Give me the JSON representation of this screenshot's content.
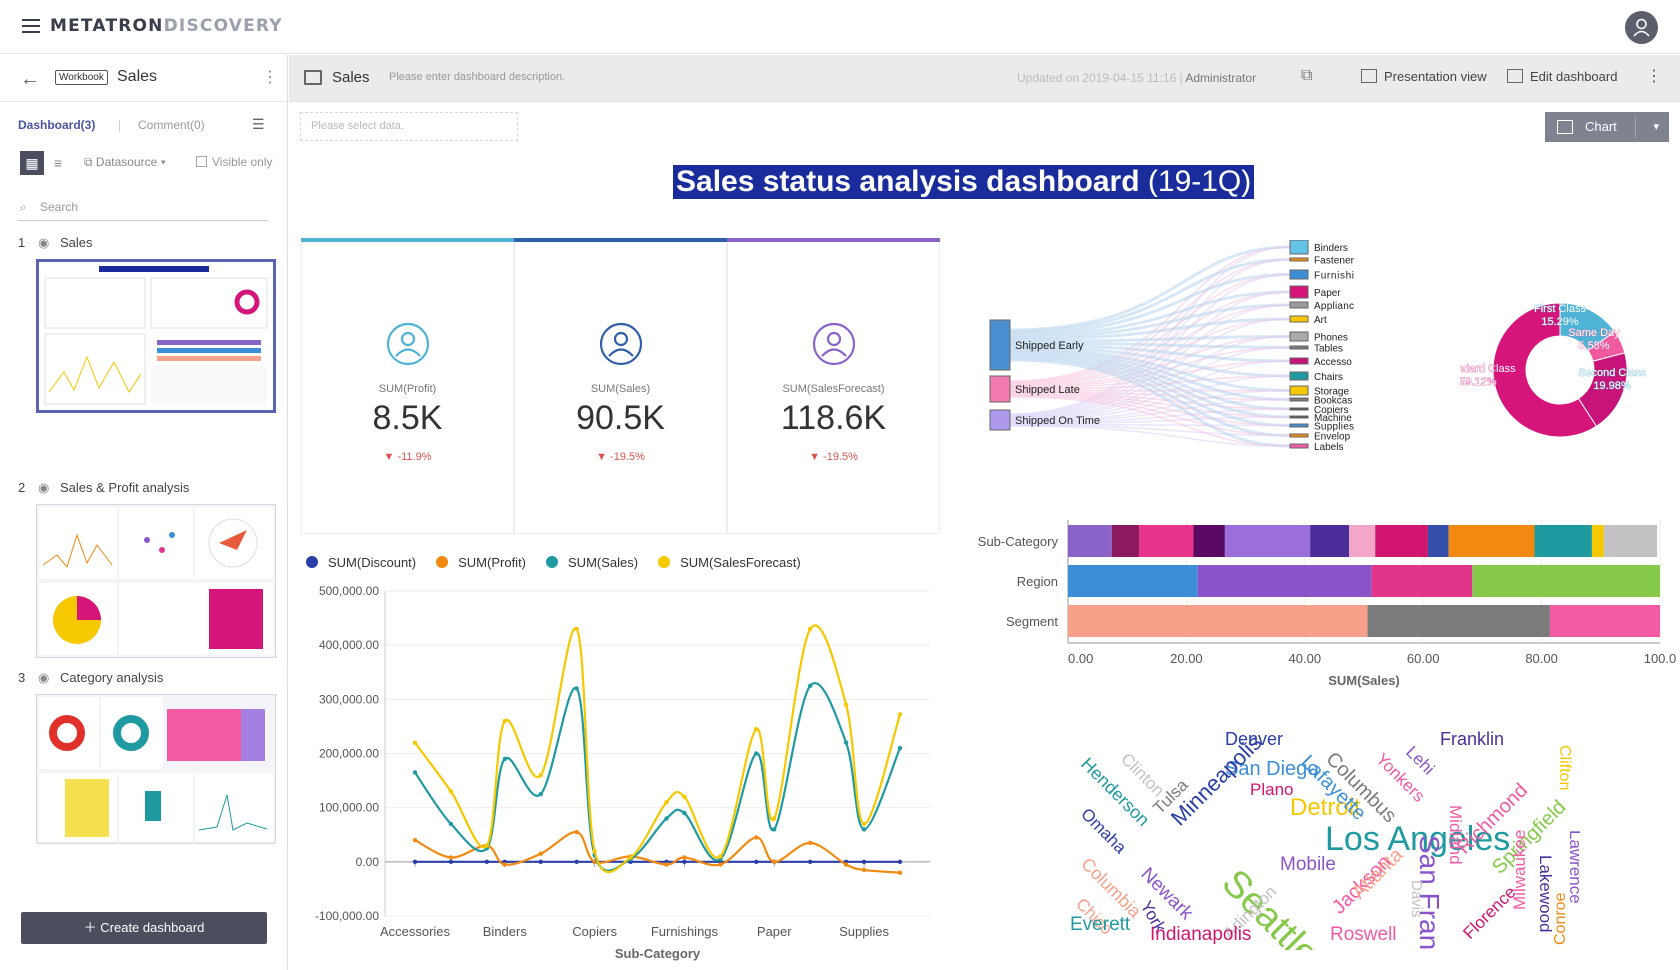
{
  "app": {
    "brand_a": "METATRON",
    "brand_b": "DISCOVERY"
  },
  "sidebar": {
    "workbook_badge": "Workbook",
    "workbook_title": "Sales",
    "tab_dashboard": "Dashboard(3)",
    "tab_comment": "Comment(0)",
    "datasource": "Datasource",
    "visible_only": "Visible only",
    "search_placeholder": "Search",
    "items": [
      {
        "num": "1",
        "label": "Sales"
      },
      {
        "num": "2",
        "label": "Sales & Profit analysis"
      },
      {
        "num": "3",
        "label": "Category analysis"
      }
    ],
    "create_label": "Create dashboard"
  },
  "header": {
    "name": "Sales",
    "description": "Please enter dashboard description.",
    "updated": "Updated on 2019-04-15 11:16 |",
    "author": "Administrator",
    "presentation": "Presentation view",
    "edit": "Edit dashboard"
  },
  "filter_placeholder": "Please select data.",
  "chart_button": "Chart",
  "dashboard_title": "Sales status analysis dashboard",
  "dashboard_title_suffix": "(19-1Q)",
  "kpis": [
    {
      "caption": "SUM(Profit)",
      "value": "8.5K",
      "change": "-11.9%",
      "color": "#4fb3d6"
    },
    {
      "caption": "SUM(Sales)",
      "value": "90.5K",
      "change": "-19.5%",
      "color": "#2f5fa6"
    },
    {
      "caption": "SUM(SalesForecast)",
      "value": "118.6K",
      "change": "-19.5%",
      "color": "#8a63c9"
    }
  ],
  "chart_data": [
    {
      "type": "line",
      "xlabel": "Sub-Category",
      "categories": [
        "Accessories",
        "Binders",
        "Copiers",
        "Furnishings",
        "Paper",
        "Supplies"
      ],
      "y_ticks": [
        "500,000.00",
        "400,000.00",
        "300,000.00",
        "200,000.00",
        "100,000.00",
        "0.00",
        "-100,000.00"
      ],
      "ylim": [
        -100000,
        500000
      ],
      "x": [
        0,
        0.4,
        0.8,
        1,
        1.4,
        1.8,
        2,
        2.4,
        2.8,
        3,
        3.4,
        3.8,
        4,
        4.4,
        4.8,
        5,
        5.4
      ],
      "series": [
        {
          "name": "SUM(Discount)",
          "color": "#2b3ea8",
          "values": [
            0,
            0,
            0,
            0,
            0,
            0,
            0,
            0,
            0,
            0,
            0,
            0,
            0,
            0,
            0,
            0,
            0
          ]
        },
        {
          "name": "SUM(Profit)",
          "color": "#f28a12",
          "values": [
            40000,
            8000,
            30000,
            -5000,
            15000,
            55000,
            0,
            10000,
            -5000,
            8000,
            -5000,
            45000,
            0,
            35000,
            -5000,
            -15000,
            -20000
          ]
        },
        {
          "name": "SUM(Sales)",
          "color": "#1f9aa0",
          "values": [
            165000,
            70000,
            25000,
            190000,
            125000,
            320000,
            12000,
            5000,
            80000,
            90000,
            5000,
            200000,
            60000,
            325000,
            220000,
            60000,
            210000
          ]
        },
        {
          "name": "SUM(SalesForecast)",
          "color": "#f5c800",
          "values": [
            220000,
            130000,
            30000,
            260000,
            160000,
            430000,
            20000,
            8000,
            110000,
            120000,
            10000,
            245000,
            80000,
            430000,
            290000,
            70000,
            272000
          ]
        }
      ]
    },
    {
      "type": "bar",
      "xlabel": "SUM(Sales)",
      "categories": [
        "Sub-Category",
        "Region",
        "Segment"
      ],
      "x_ticks": [
        "0.00",
        "20.00",
        "40.00",
        "60.00",
        "80.00",
        "100.0"
      ],
      "xlim": [
        0,
        100
      ],
      "stacks": [
        [
          [
            "#8a63c9",
            7.4
          ],
          [
            "#8b1a5e",
            4.6
          ],
          [
            "#e7358b",
            9.2
          ],
          [
            "#5a0a63",
            5.3
          ],
          [
            "#9b6fdb",
            14.4
          ],
          [
            "#4b2e9a",
            6.6
          ],
          [
            "#f4a6c8",
            4.4
          ],
          [
            "#d1156f",
            8.9
          ],
          [
            "#334faa",
            3.5
          ],
          [
            "#f28a12",
            14.5
          ],
          [
            "#1f9aa0",
            9.7
          ],
          [
            "#f5c800",
            2.0
          ],
          [
            "#c2c2c2",
            9.0
          ]
        ],
        [
          [
            "#3c8fd6",
            21.9
          ],
          [
            "#8a55c9",
            29.4
          ],
          [
            "#e0358b",
            17.0
          ],
          [
            "#86c94a",
            31.7
          ]
        ],
        [
          [
            "#f9a08a",
            50.6
          ],
          [
            "#7b7b7b",
            30.8
          ],
          [
            "#f25aa4",
            18.6
          ]
        ]
      ]
    },
    {
      "type": "pie",
      "slices": [
        {
          "name": "First Class",
          "value": 15.29,
          "color": "#4fb3d6"
        },
        {
          "name": "Same Day",
          "value": 5.58,
          "color": "#f05a9f"
        },
        {
          "name": "Second Class",
          "value": 19.98,
          "color": "#c8147a"
        },
        {
          "name": "Standard Class",
          "value": 59.12,
          "color": "#d6157b"
        }
      ]
    }
  ],
  "sankey": {
    "sources": [
      "Shipped Early",
      "Shipped Late",
      "Shipped On Time"
    ],
    "targets": [
      "Binders",
      "Fastener",
      "Furnishi",
      "Paper",
      "Applianc",
      "Art",
      "Phones",
      "Tables",
      "Accesso",
      "Chairs",
      "Storage",
      "Bookcas",
      "Copiers",
      "Machine",
      "Supplies",
      "Envelop",
      "Labels"
    ]
  },
  "pie_labels": [
    {
      "name": "First Class",
      "pct": "15.29%"
    },
    {
      "name": "Same Day",
      "pct": "5.58%"
    },
    {
      "name": "Second Class",
      "pct": "19.98%"
    },
    {
      "name": "Standard Class",
      "pct": "59.12%"
    }
  ],
  "wordcloud": [
    {
      "w": "Los Angeles",
      "s": 34,
      "c": "#1f9aa0"
    },
    {
      "w": "Seattle",
      "s": 38,
      "c": "#86c94a",
      "r": 45
    },
    {
      "w": "San Francisco",
      "s": 28,
      "c": "#8a55c9",
      "r": 90
    },
    {
      "w": "Detroit",
      "s": 24,
      "c": "#f5c800"
    },
    {
      "w": "San Diego",
      "s": 20,
      "c": "#3c8fd6"
    },
    {
      "w": "Minneapolis",
      "s": 22,
      "c": "#2b3ea8",
      "r": -45
    },
    {
      "w": "Denver",
      "s": 18,
      "c": "#2b3ea8"
    },
    {
      "w": "Franklin",
      "s": 18,
      "c": "#4b2e9a"
    },
    {
      "w": "Henderson",
      "s": 18,
      "c": "#1f9aa0",
      "r": 45
    },
    {
      "w": "Lafayette",
      "s": 20,
      "c": "#3c8fd6",
      "r": 45
    },
    {
      "w": "Columbus",
      "s": 20,
      "c": "#7b7b7b",
      "r": 45
    },
    {
      "w": "Yonkers",
      "s": 17,
      "c": "#f25aa4",
      "r": 45
    },
    {
      "w": "Lehi",
      "s": 17,
      "c": "#8a55c9",
      "r": 45
    },
    {
      "w": "Midland",
      "s": 17,
      "c": "#f25aa4",
      "r": 90
    },
    {
      "w": "Richmond",
      "s": 20,
      "c": "#f25aa4",
      "r": -45
    },
    {
      "w": "Clinton",
      "s": 17,
      "c": "#c2c2c2",
      "r": 45
    },
    {
      "w": "Tulsa",
      "s": 17,
      "c": "#7b7b7b",
      "r": -45
    },
    {
      "w": "Plano",
      "s": 17,
      "c": "#d1156f"
    },
    {
      "w": "Mobile",
      "s": 19,
      "c": "#8a55c9"
    },
    {
      "w": "Omaha",
      "s": 17,
      "c": "#2b3ea8",
      "r": 45
    },
    {
      "w": "Columbia",
      "s": 18,
      "c": "#f9a08a",
      "r": 45
    },
    {
      "w": "Newark",
      "s": 19,
      "c": "#8a55c9",
      "r": 45
    },
    {
      "w": "York",
      "s": 17,
      "c": "#4b2e9a",
      "r": 60
    },
    {
      "w": "Chico",
      "s": 17,
      "c": "#f9a08a",
      "r": 45
    },
    {
      "w": "Arlington",
      "s": 17,
      "c": "#c2c2c2",
      "r": -45
    },
    {
      "w": "Jackson",
      "s": 20,
      "c": "#f25aa4",
      "r": -45
    },
    {
      "w": "Atlanta",
      "s": 20,
      "c": "#f9a08a",
      "r": -45
    },
    {
      "w": "Springfield",
      "s": 20,
      "c": "#86c94a",
      "r": -45
    },
    {
      "w": "Florence",
      "s": 17,
      "c": "#d1156f",
      "r": -45
    },
    {
      "w": "Milwaukee",
      "s": 17,
      "c": "#f25aa4",
      "r": -90
    },
    {
      "w": "Lakewood",
      "s": 17,
      "c": "#4b2e9a",
      "r": 90
    },
    {
      "w": "Lawrence",
      "s": 17,
      "c": "#8a55c9",
      "r": 90
    },
    {
      "w": "Conroe",
      "s": 16,
      "c": "#f28a12",
      "r": -90
    },
    {
      "w": "Clifton",
      "s": 16,
      "c": "#f5c800",
      "r": 90
    },
    {
      "w": "Davis",
      "s": 15,
      "c": "#c2c2c2",
      "r": 90
    },
    {
      "w": "Everett",
      "s": 19,
      "c": "#1f9aa0"
    },
    {
      "w": "Indianapolis",
      "s": 19,
      "c": "#d1156f"
    },
    {
      "w": "Roswell",
      "s": 19,
      "c": "#f25aa4"
    }
  ]
}
